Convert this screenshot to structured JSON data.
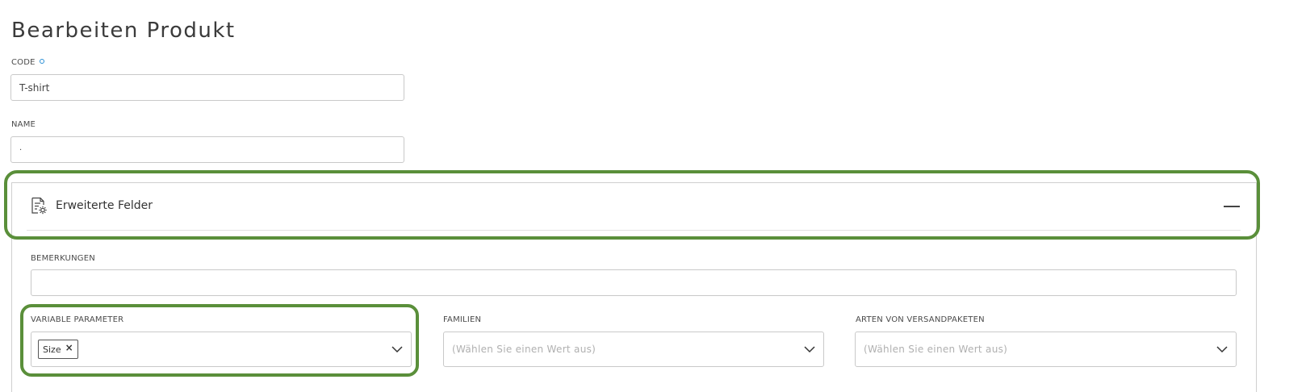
{
  "page": {
    "title": "Bearbeiten Produkt"
  },
  "fields": {
    "code": {
      "label": "CODE",
      "value": "T-shirt"
    },
    "name": {
      "label": "NAME",
      "value": "."
    }
  },
  "advanced": {
    "title": "Erweiterte Felder",
    "icon": "document-settings-icon",
    "collapse_icon": "minus-icon",
    "remarks": {
      "label": "BEMERKUNGEN",
      "value": ""
    },
    "variable_parameter": {
      "label": "VARIABLE PARAMETER",
      "tags": [
        "Size"
      ],
      "remove_symbol": "×"
    },
    "families": {
      "label": "FAMILIEN",
      "placeholder": "(Wählen Sie einen Wert aus)"
    },
    "package_types": {
      "label": "ARTEN VON VERSANDPAKETEN",
      "placeholder": "(Wählen Sie einen Wert aus)"
    }
  },
  "colors": {
    "highlight": "#5a8f3a",
    "required": "#2a8fd6"
  }
}
